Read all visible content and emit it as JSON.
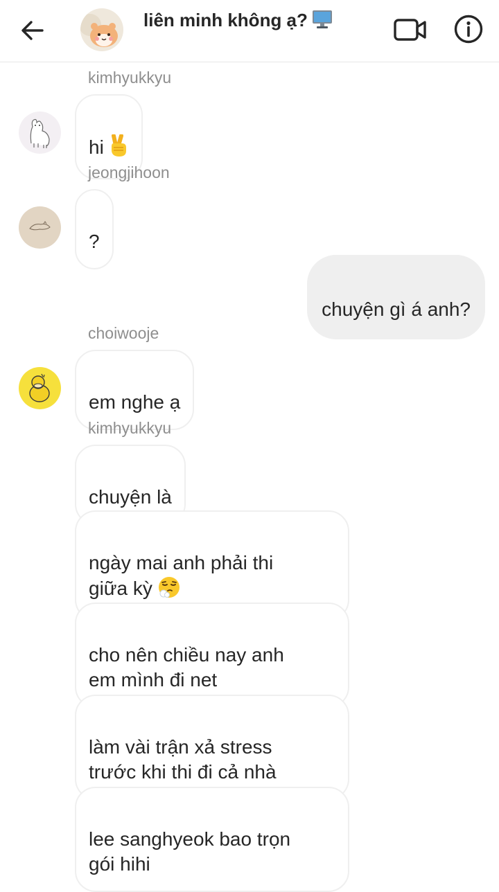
{
  "header": {
    "back_icon": "arrow-left-icon",
    "title": "liên minh không ạ?",
    "title_icon": "desktop-computer-icon",
    "video_icon": "video-camera-icon",
    "info_icon": "info-circle-icon"
  },
  "messages": [
    {
      "sender": "kimhyukkyu",
      "text": "hi",
      "emoji": "victory-hand-emoji"
    },
    {
      "sender": "jeongjihoon",
      "text": "?"
    },
    {
      "outgoing": true,
      "text": "chuyện gì á anh?"
    },
    {
      "sender": "choiwooje",
      "text": "em nghe ạ"
    },
    {
      "sender": "kimhyukkyu",
      "text": "chuyện là"
    },
    {
      "text": "ngày mai anh phải thi\ngiữa kỳ",
      "emoji": "face-exhaling-emoji"
    },
    {
      "text": "cho nên chiều nay anh\nem mình đi net"
    },
    {
      "text": "làm vài trận xả stress\ntrước khi thi đi cả nhà"
    },
    {
      "text": "lee sanghyeok bao trọn\ngói hihi"
    }
  ],
  "colors": {
    "incoming_bubble": "#ffffff",
    "incoming_border": "#efefef",
    "outgoing_bubble": "#efefef",
    "sender_text": "#8e8e8e",
    "text": "#262626"
  }
}
